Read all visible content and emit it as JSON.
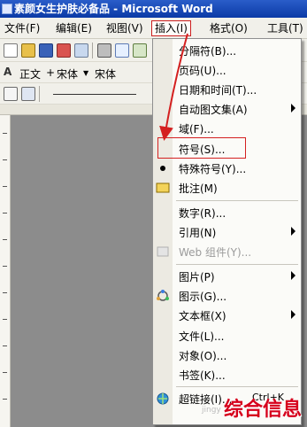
{
  "window": {
    "title": "素颜女生护肤必备品 - Microsoft Word"
  },
  "menubar": {
    "items": [
      {
        "label": "文件(F)",
        "active": false
      },
      {
        "label": "编辑(E)",
        "active": false
      },
      {
        "label": "视图(V)",
        "active": false
      },
      {
        "label": "插入(I)",
        "active": true
      },
      {
        "label": "格式(O)",
        "active": false
      },
      {
        "label": "工具(T)",
        "active": false
      }
    ]
  },
  "format_toolbar": {
    "style_value": "正文",
    "plus": "+",
    "font_east": "宋体",
    "font_west": "宋体"
  },
  "insert_menu": {
    "items": [
      {
        "label": "分隔符(B)...",
        "icon": null,
        "submenu": false,
        "disabled": false
      },
      {
        "label": "页码(U)...",
        "icon": null,
        "submenu": false,
        "disabled": false
      },
      {
        "label": "日期和时间(T)...",
        "icon": null,
        "submenu": false,
        "disabled": false
      },
      {
        "label": "自动图文集(A)",
        "icon": null,
        "submenu": true,
        "disabled": false
      },
      {
        "label": "域(F)...",
        "icon": null,
        "submenu": false,
        "disabled": false
      },
      {
        "label": "符号(S)...",
        "icon": null,
        "submenu": false,
        "disabled": false,
        "highlighted": true
      },
      {
        "label": "特殊符号(Y)...",
        "icon": "dot-icon",
        "submenu": false,
        "disabled": false
      },
      {
        "label": "批注(M)",
        "icon": "comment-icon",
        "submenu": false,
        "disabled": false
      },
      {
        "label": "数字(R)...",
        "icon": null,
        "submenu": false,
        "disabled": false
      },
      {
        "label": "引用(N)",
        "icon": null,
        "submenu": true,
        "disabled": false
      },
      {
        "label": "Web 组件(Y)...",
        "icon": "web-component-icon",
        "submenu": false,
        "disabled": true
      },
      {
        "label": "图片(P)",
        "icon": null,
        "submenu": true,
        "disabled": false
      },
      {
        "label": "图示(G)...",
        "icon": "diagram-icon",
        "submenu": false,
        "disabled": false
      },
      {
        "label": "文本框(X)",
        "icon": null,
        "submenu": true,
        "disabled": false
      },
      {
        "label": "文件(L)...",
        "icon": null,
        "submenu": false,
        "disabled": false
      },
      {
        "label": "对象(O)...",
        "icon": null,
        "submenu": false,
        "disabled": false
      },
      {
        "label": "书签(K)...",
        "icon": null,
        "submenu": false,
        "disabled": false
      },
      {
        "label": "超链接(I)...",
        "icon": "hyperlink-icon",
        "submenu": false,
        "disabled": false,
        "shortcut": "Ctrl+K"
      }
    ]
  },
  "watermark": {
    "text": "综合信息",
    "small": "jingy"
  },
  "colors": {
    "accent_red": "#d42020",
    "title_blue": "#0b3aa6"
  }
}
